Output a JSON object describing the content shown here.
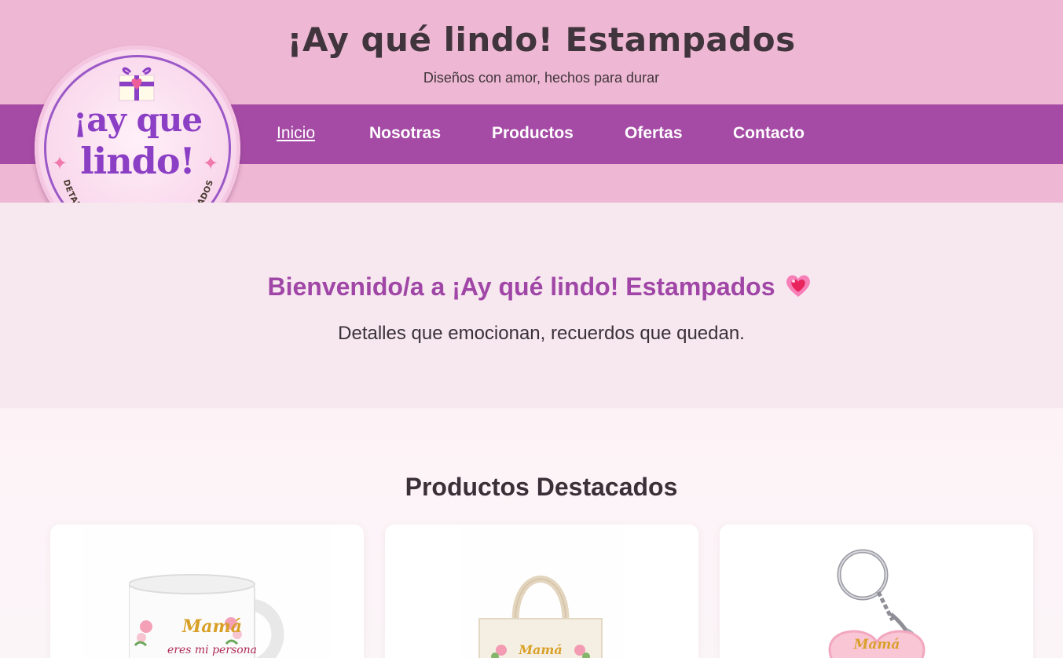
{
  "header": {
    "site_title": "¡Ay qué lindo! Estampados",
    "tagline": "Diseños con amor, hechos para durar"
  },
  "logo": {
    "line1": "¡ay que",
    "line2": "lindo!",
    "arc_text": "DETALLES Y REGALOS PERSONALIZADOS"
  },
  "nav": {
    "items": [
      {
        "label": "Inicio",
        "active": true
      },
      {
        "label": "Nosotras"
      },
      {
        "label": "Productos"
      },
      {
        "label": "Ofertas"
      },
      {
        "label": "Contacto"
      }
    ]
  },
  "hero": {
    "title": "Bienvenido/a a ¡Ay qué lindo! Estampados",
    "subtitle": "Detalles que emocionan, recuerdos que quedan.",
    "icon": "sparkling-heart-icon"
  },
  "products": {
    "section_title": "Productos Destacados",
    "items": [
      {
        "name": "mug",
        "print_line1": "Mamá",
        "print_line2": "eres mi persona"
      },
      {
        "name": "tote-bag",
        "print_line1": "Mamá"
      },
      {
        "name": "keychain",
        "print_line1": "Mamá"
      }
    ]
  },
  "colors": {
    "header_bg": "#eeb7d3",
    "nav_bg": "#a54ba5",
    "hero_bg": "#f7e8f0",
    "accent": "#a046a6"
  }
}
